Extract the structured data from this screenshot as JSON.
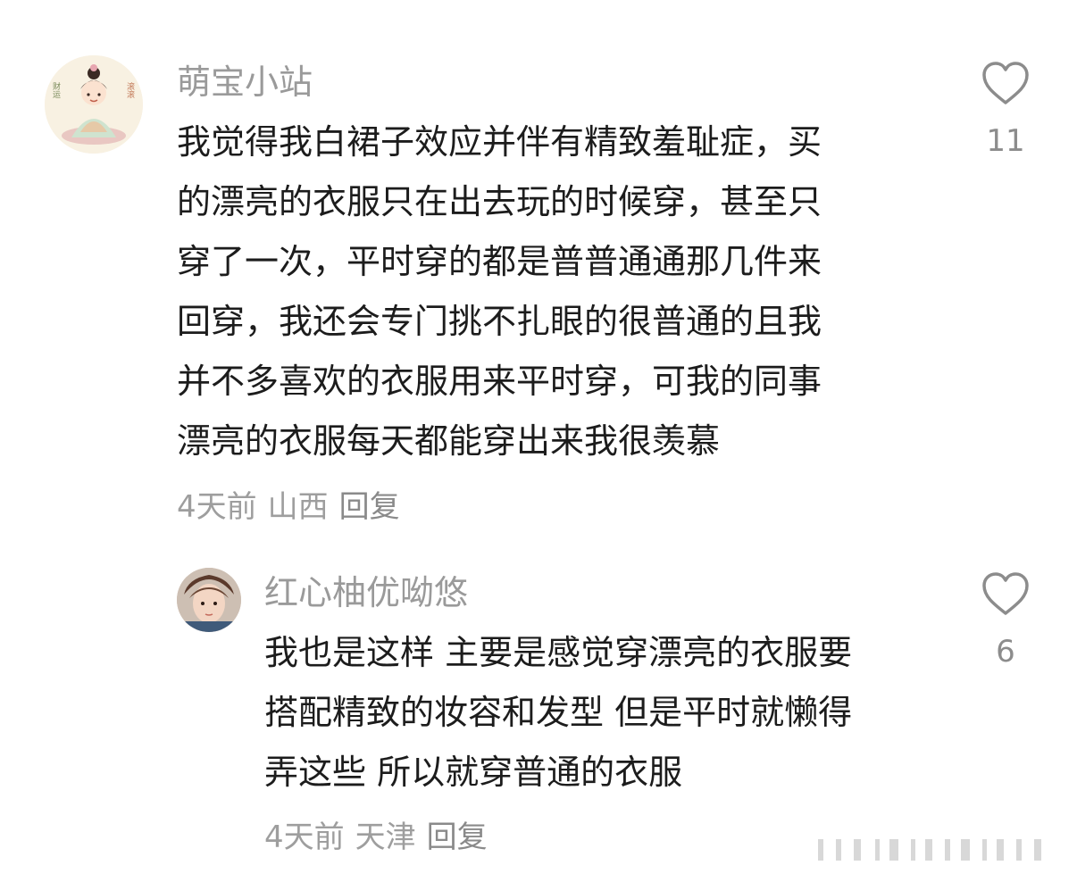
{
  "comments": [
    {
      "username": "萌宝小站",
      "text": "我觉得我白裙子效应并伴有精致羞耻症，买\n的漂亮的衣服只在出去玩的时候穿，甚至只\n穿了一次，平时穿的都是普普通通那几件来\n回穿，我还会专门挑不扎眼的很普通的且我\n并不多喜欢的衣服用来平时穿，可我的同事\n漂亮的衣服每天都能穿出来我很羡慕",
      "time": "4天前",
      "location": "山西",
      "reply_label": "回复",
      "likes": "11",
      "avatar_text_left": "财运",
      "avatar_text_right": "滚滚"
    },
    {
      "username": "红心柚优呦悠",
      "text": "我也是这样 主要是感觉穿漂亮的衣服要\n搭配精致的妆容和发型 但是平时就懒得\n弄这些 所以就穿普通的衣服",
      "time": "4天前",
      "location": "天津",
      "reply_label": "回复",
      "likes": "6"
    }
  ],
  "colors": {
    "username": "#9a9a9a",
    "body": "#1c1c1c",
    "meta": "#9e9e9e",
    "icon": "#8c8c8c"
  }
}
